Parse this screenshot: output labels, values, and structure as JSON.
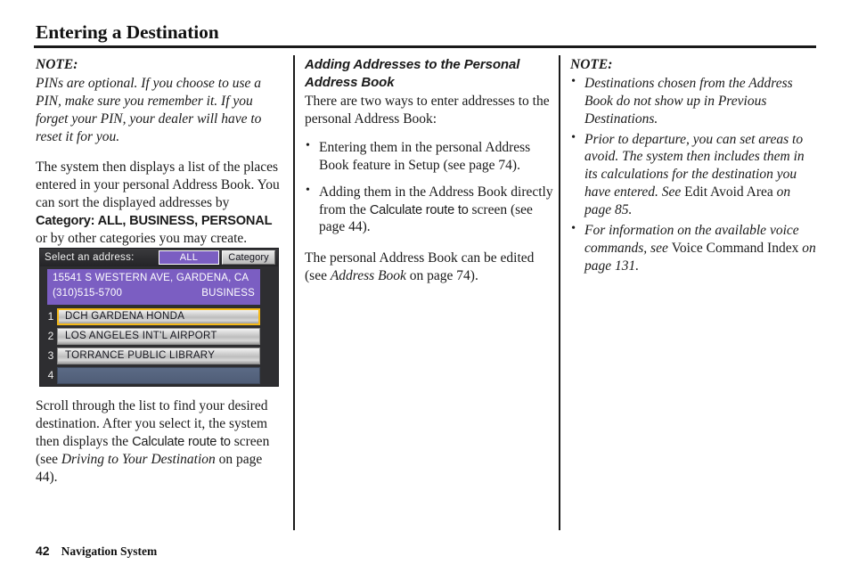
{
  "title": "Entering a Destination",
  "left_column": {
    "note_label": "NOTE:",
    "note_text": "PINs are optional. If you choose to use a PIN, make sure you remember it. If you forget your PIN, your dealer will have to reset it for you.",
    "para1_a": "The system then displays a list of the places entered in your personal Address Book. You can sort the displayed addresses by ",
    "para1_b": "Category: ALL, BUSINESS, PERSONAL",
    "para1_c": " or by other categories you may create.",
    "para2_a": "Scroll through the list to find your desired destination. After you select it, the system then displays the ",
    "para2_b": "Calculate route to",
    "para2_c": " screen (see ",
    "para2_d": "Driving to Your Destination",
    "para2_e": " on page 44)."
  },
  "nav_screen": {
    "header_title": "Select an address:",
    "button_all": "ALL",
    "button_category": "Category",
    "banner_address": "15541 S WESTERN AVE, GARDENA, CA",
    "banner_phone": "(310)515-5700",
    "banner_category": "BUSINESS",
    "rows": [
      {
        "num": "1",
        "label": "DCH GARDENA HONDA",
        "selected": true,
        "empty": false
      },
      {
        "num": "2",
        "label": "LOS ANGELES INT'L AIRPORT",
        "selected": false,
        "empty": false
      },
      {
        "num": "3",
        "label": "TORRANCE PUBLIC LIBRARY",
        "selected": false,
        "empty": false
      },
      {
        "num": "4",
        "label": "",
        "selected": false,
        "empty": true
      }
    ],
    "colors": {
      "accent_purple": "#7b5ec2",
      "selection_gold": "#f5b919",
      "bezel": "#2e2e31",
      "empty_row": "#4f5d77"
    }
  },
  "middle_column": {
    "heading": "Adding Addresses to the Personal Address Book",
    "intro": "There are two ways to enter addresses to the personal Address Book:",
    "bullet1_a": "Entering them in the personal Address Book feature in Setup (see page 74).",
    "bullet2_a": "Adding them in the Address Book directly from the ",
    "bullet2_b": "Calculate route to",
    "bullet2_c": " screen (see page 44).",
    "closing_a": "The personal Address Book can be edited (see ",
    "closing_b": "Address Book",
    "closing_c": " on page 74)."
  },
  "right_column": {
    "note_label": "NOTE:",
    "bullet1": "Destinations chosen from the Address Book do not show up in Previous Destinations.",
    "bullet2_a": "Prior to departure, you can set areas to avoid. The system then includes them in its calculations for the destination you have entered. See ",
    "bullet2_b": "Edit Avoid Area",
    "bullet2_c": " on page 85.",
    "bullet3_a": "For information on the available voice commands, see ",
    "bullet3_b": "Voice Command Index",
    "bullet3_c": " on page 131."
  },
  "footer": {
    "page_number": "42",
    "section_label": "Navigation System"
  }
}
